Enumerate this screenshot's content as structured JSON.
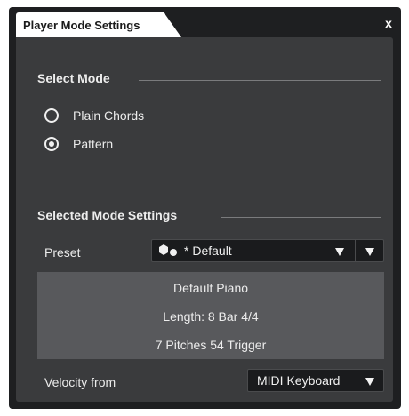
{
  "dialog": {
    "tab_title": "Player Mode Settings",
    "close_label": "x"
  },
  "select_mode": {
    "title": "Select Mode",
    "options": [
      {
        "label": "Plain Chords",
        "checked": false
      },
      {
        "label": "Pattern",
        "checked": true
      }
    ]
  },
  "selected_mode_settings": {
    "title": "Selected Mode Settings",
    "preset": {
      "label": "Preset",
      "value": "* Default",
      "icon": "preset-shapes-icon"
    },
    "info": {
      "line1": "Default Piano",
      "line2": "Length: 8  Bar 4/4",
      "line3": "7 Pitches 54 Trigger"
    },
    "velocity": {
      "label": "Velocity from",
      "value": "MIDI Keyboard"
    }
  },
  "colors": {
    "window_bg": "#1e1f21",
    "panel_bg": "#3a3b3d",
    "info_bg": "#58595c",
    "field_bg": "#1a1b1d",
    "tab_bg": "#ffffff"
  }
}
